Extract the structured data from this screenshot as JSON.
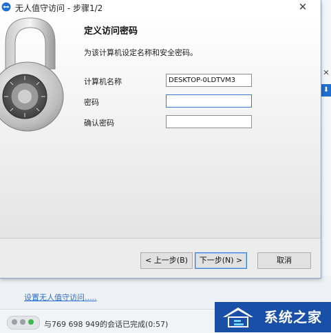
{
  "window": {
    "title": "无人值守访问 - 步骤1/2",
    "close_glyph": "✕"
  },
  "page": {
    "heading": "定义访问密码",
    "subtitle": "为该计算机设定名称和安全密码。"
  },
  "form": {
    "computer_name_label": "计算机名称",
    "computer_name_value": "DESKTOP-0LDTVM3",
    "password_label": "密码",
    "password_value": "",
    "confirm_label": "确认密码",
    "confirm_value": ""
  },
  "buttons": {
    "back": "< 上一步(B)",
    "next": "下一步(N) >",
    "cancel": "取消"
  },
  "background": {
    "link": "设置无人值守访问.....",
    "status": "与769 698 949的会话已完成(0:57)",
    "status_dot_colors": [
      "#9aa0a6",
      "#9aa0a6",
      "#3fb84f"
    ],
    "right_close_glyph": "✕",
    "right_download_glyph": "⬇",
    "brand_text": "系统之家",
    "brand_color": "#1a4fa8"
  }
}
